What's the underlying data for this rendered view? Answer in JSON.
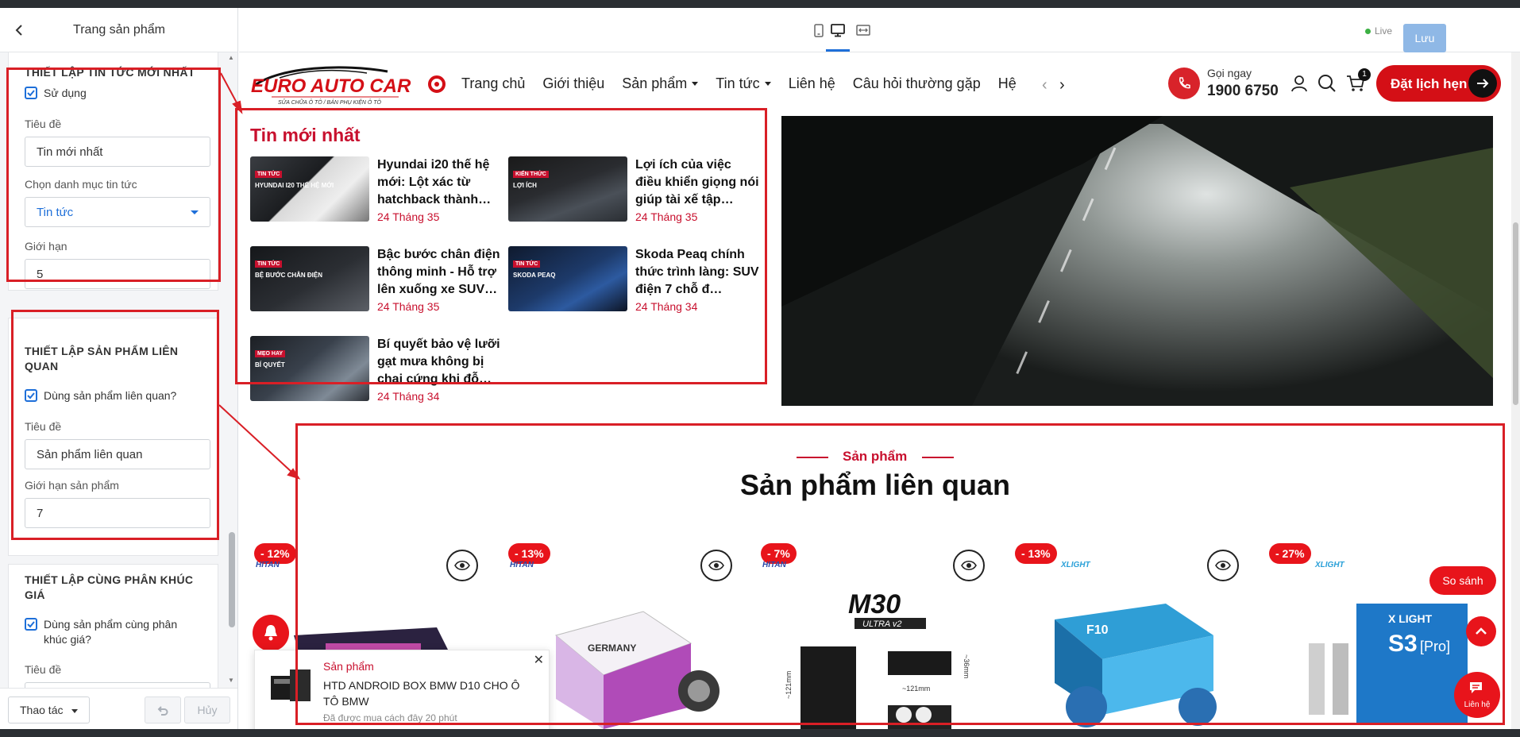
{
  "panel": {
    "title": "Trang sản phẩm",
    "news_section": {
      "title": "THIẾT LẬP TIN TỨC MỚI NHẤT",
      "use_label": "Sử dụng",
      "title_label": "Tiêu đề",
      "title_value": "Tin mới nhất",
      "category_label": "Chọn danh mục tin tức",
      "category_value": "Tin tức",
      "limit_label": "Giới hạn",
      "limit_value": "5"
    },
    "related_section": {
      "title": "THIẾT LẬP SẢN PHẨM LIÊN QUAN",
      "use_label": "Dùng sản phẩm liên quan?",
      "title_label": "Tiêu đề",
      "title_value": "Sản phẩm liên quan",
      "limit_label": "Giới hạn sản phẩm",
      "limit_value": "7"
    },
    "price_section": {
      "title": "THIẾT LẬP CÙNG PHÂN KHÚC GIÁ",
      "use_label": "Dùng sản phẩm cùng phân khúc giá?",
      "title_label": "Tiêu đề"
    },
    "footer": {
      "action_label": "Thao tác",
      "cancel_label": "Hủy"
    }
  },
  "toolbar": {
    "live_label": "Live",
    "save_label": "Lưu"
  },
  "site": {
    "logo_text": "EURO AUTO CAR",
    "logo_tagline": "SỬA CHỮA Ô TÔ  /  BÁN PHỤ KIỆN Ô TÔ",
    "nav": [
      "Trang chủ",
      "Giới thiệu",
      "Sản phẩm",
      "Tin tức",
      "Liên hệ",
      "Câu hỏi thường gặp",
      "Hệ"
    ],
    "call_label": "Gọi ngay",
    "call_number": "1900 6750",
    "cart_count": "1",
    "book_label": "Đặt lịch hẹn"
  },
  "news": {
    "title": "Tin mới nhất",
    "items": [
      {
        "title": "Hyundai i20 thế hệ mới: Lột xác từ hatchback thành…",
        "date": "24 Tháng 35",
        "tag": "TIN TỨC",
        "caption": "HYUNDAI I20 THẾ HỆ MỚI"
      },
      {
        "title": "Lợi ích của việc điều khiển giọng nói giúp tài xế tập…",
        "date": "24 Tháng 35",
        "tag": "KIẾN THỨC",
        "caption": "LỢI ÍCH"
      },
      {
        "title": "Bậc bước chân điện thông minh - Hỗ trợ lên xuống xe SUV…",
        "date": "24 Tháng 35",
        "tag": "TIN TỨC",
        "caption": "BỆ BƯỚC CHÂN ĐIỆN"
      },
      {
        "title": "Skoda Peaq chính thức trình làng: SUV điện 7 chỗ đ…",
        "date": "24 Tháng 34",
        "tag": "TIN TỨC",
        "caption": "SKODA PEAQ"
      },
      {
        "title": "Bí quyết bảo vệ lưỡi gạt mưa không bị chai cứng khi đỗ…",
        "date": "24 Tháng 34",
        "tag": "MẸO HAY",
        "caption": "BÍ QUYẾT"
      }
    ]
  },
  "related": {
    "kicker": "Sản phẩm",
    "title": "Sản phẩm liên quan",
    "products": [
      {
        "discount": "- 12%",
        "brand": "HITAN"
      },
      {
        "discount": "- 13%",
        "brand": "HITAN"
      },
      {
        "discount": "- 7%",
        "brand": "HITAN"
      },
      {
        "discount": "- 13%",
        "brand": "XLIGHT"
      },
      {
        "discount": "- 27%",
        "brand": "XLIGHT"
      }
    ],
    "product_labels": {
      "m30": "M30",
      "m30_sub": "ULTRA v2",
      "dim1": "~121mm",
      "dim2": "~121mm",
      "dim3": "~36mm",
      "s3": "S3",
      "s3_pro": "[Pro]",
      "xlight": "X LIGHT",
      "f10": "F10",
      "germany": "GERMANY"
    }
  },
  "floating": {
    "compare_label": "So sánh",
    "chat_label": "Liên hệ"
  },
  "popup": {
    "category": "Sản phẩm",
    "name": "HTD ANDROID BOX BMW D10 CHO Ô TÔ BMW",
    "time": "Đã được mua cách đây 20 phút"
  },
  "colors": {
    "brand_red": "#d40f16",
    "accent_blue": "#1e6fd9",
    "annotation_red": "#d91f26"
  }
}
